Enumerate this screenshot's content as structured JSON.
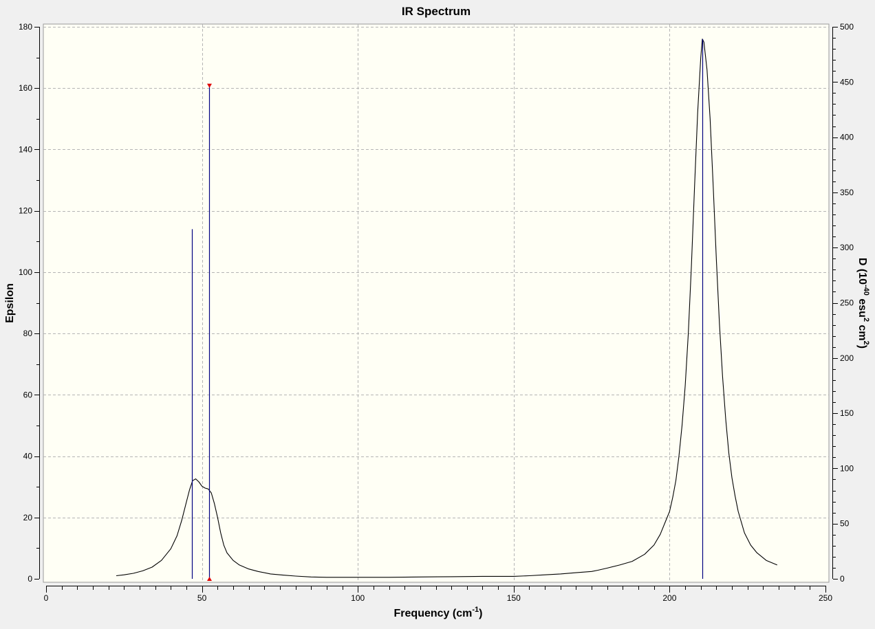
{
  "chart_data": {
    "type": "line",
    "title": "IR Spectrum",
    "xlabel": "Frequency (cm",
    "xlabel_sup": "-1",
    "xlabel_tail": ")",
    "ylabel": "Epsilon",
    "ylabel2_parts": [
      "D (10",
      "-40",
      " esu",
      "2",
      " cm",
      "2",
      ")"
    ],
    "xlim": [
      0,
      250
    ],
    "ylim": [
      0,
      180
    ],
    "y2lim": [
      0,
      500
    ],
    "xticks": [
      0,
      50,
      100,
      150,
      200,
      250
    ],
    "yticks": [
      0,
      20,
      40,
      60,
      80,
      100,
      120,
      140,
      160,
      180
    ],
    "y2ticks": [
      0,
      50,
      100,
      150,
      200,
      250,
      300,
      350,
      400,
      450,
      500
    ],
    "grid": true,
    "colors": {
      "plot_bg": "#fffff5",
      "curve": "#000000",
      "sticks": "#000080",
      "marker": "#e00000",
      "grid": "#b4b4b4"
    },
    "series": [
      {
        "x": [
          22.5,
          25,
          28,
          31,
          34,
          37,
          40,
          42,
          43.5,
          45,
          46,
          47,
          48,
          49,
          50,
          51,
          52,
          53,
          54,
          55,
          56,
          57,
          58,
          60,
          62,
          65,
          68,
          72,
          76,
          80,
          85,
          90,
          100,
          110,
          120,
          130,
          140,
          150,
          155,
          160,
          165,
          170,
          175,
          177,
          180,
          184,
          188,
          192,
          195,
          197,
          199,
          200,
          201,
          202,
          203,
          204,
          205,
          206,
          207,
          208,
          209,
          210,
          210.5,
          211,
          212,
          213,
          214,
          215,
          216,
          217,
          218,
          219,
          220,
          221,
          222,
          224,
          226,
          228,
          231,
          234.5
        ],
        "y": [
          1.0,
          1.3,
          1.8,
          2.6,
          3.8,
          6.0,
          9.8,
          14.0,
          19.0,
          25.0,
          29.0,
          32.0,
          32.6,
          31.6,
          30.2,
          29.6,
          29.3,
          28.0,
          24.5,
          20.0,
          15.0,
          11.0,
          8.5,
          6.0,
          4.5,
          3.2,
          2.4,
          1.6,
          1.2,
          0.9,
          0.6,
          0.5,
          0.5,
          0.5,
          0.6,
          0.7,
          0.8,
          0.8,
          1.0,
          1.3,
          1.6,
          2.0,
          2.4,
          2.8,
          3.5,
          4.5,
          5.7,
          8.0,
          11.0,
          14.5,
          19.5,
          22.0,
          26.5,
          32.0,
          40.0,
          50.0,
          63.0,
          80.0,
          102.0,
          128.0,
          152.0,
          170.0,
          176.0,
          175.0,
          166.0,
          150.0,
          128.0,
          104.0,
          83.0,
          66.0,
          52.0,
          41.0,
          33.0,
          27.0,
          22.0,
          15.0,
          11.0,
          8.5,
          6.0,
          4.5
        ]
      }
    ],
    "sticks": [
      {
        "x": 46.8,
        "epsilon": 114.0
      },
      {
        "x": 52.3,
        "epsilon": 161.0
      },
      {
        "x": 210.6,
        "epsilon": 176.0
      }
    ],
    "selected_stick": 1
  }
}
